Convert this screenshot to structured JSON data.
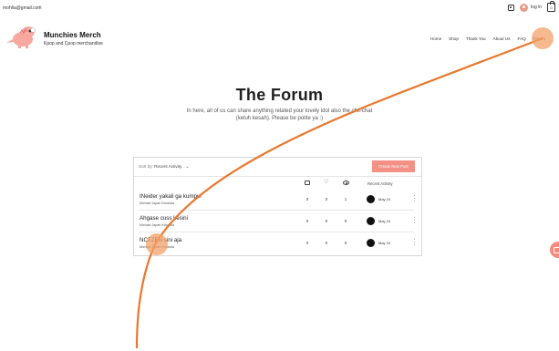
{
  "topbar": {
    "email": "mohlia@gmail.com",
    "arrow": "›",
    "login_label": "log in",
    "cart_count": "0"
  },
  "header": {
    "brand_title": "Munchies Merch",
    "brand_subtitle": "Kpop and Cpop merchandise",
    "nav": [
      "Home",
      "Shop",
      "Thank You",
      "About Us",
      "FAQ",
      "Forum"
    ]
  },
  "main": {
    "title": "The Forum",
    "subtitle_line1": "In here, all of us can share anything related your lovely idol also the chit-chat",
    "subtitle_line2": "(keluh kesah). Please be polite ya :)"
  },
  "forum": {
    "sort_label": "Sort by:",
    "sort_value": "Recent Activity",
    "create_button": "Create New Post",
    "recent_activity_header": "Recent Activity",
    "posts": [
      {
        "title": "INeider yakali ga kumpul",
        "author": "Michael Japari Kiwanda",
        "comments": "0",
        "likes": "0",
        "views": "1",
        "date": "May 24"
      },
      {
        "title": "Ahgase cuss kesini",
        "author": "Michael Japari Kiwanda",
        "comments": "0",
        "likes": "0",
        "views": "0",
        "date": "May 24"
      },
      {
        "title": "NCTZEN sini aja",
        "author": "Michael Japari Kiwanda",
        "comments": "0",
        "likes": "0",
        "views": "0",
        "date": "May 24"
      }
    ]
  },
  "colors": {
    "accent": "#f49187",
    "cursor_trail": "#e8782e"
  },
  "icons": [
    "settings-icon",
    "user-avatar-icon",
    "cart-icon",
    "chevron-down-icon",
    "comment-icon",
    "heart-icon",
    "eye-icon",
    "more-icon",
    "chat-icon"
  ]
}
